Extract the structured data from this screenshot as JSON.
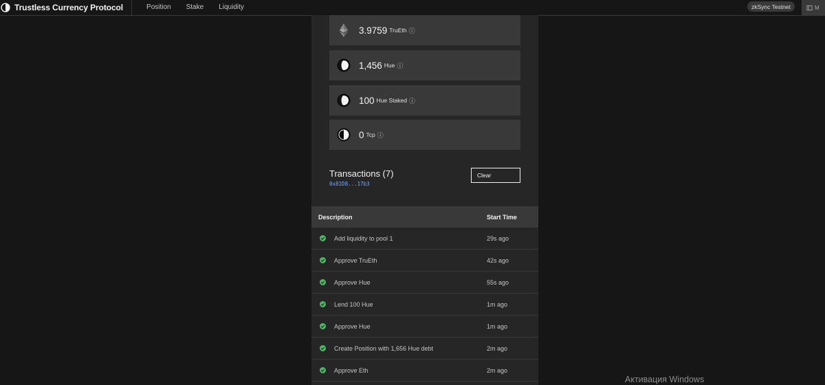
{
  "header": {
    "brand": "Trustless Currency Protocol",
    "nav": [
      "Position",
      "Stake",
      "Liquidity"
    ],
    "network": "zkSync Testnet",
    "wallet_label": "M"
  },
  "balances": [
    {
      "amount": "3.9759",
      "unit": "TruEth",
      "icon": "ethereum-icon"
    },
    {
      "amount": "1,456",
      "unit": "Hue",
      "icon": "hue-icon"
    },
    {
      "amount": "100",
      "unit": "Hue Staked",
      "icon": "hue-staked-icon"
    },
    {
      "amount": "0",
      "unit": "Tcp",
      "icon": "tcp-icon"
    }
  ],
  "info_glyph": "ⓘ",
  "transactions": {
    "title": "Transactions (7)",
    "address": "0x81D8...17b3",
    "clear_label": "Clear",
    "columns": [
      "Description",
      "Start Time"
    ],
    "rows": [
      {
        "description": "Add liquidity to pool 1",
        "time": "29s ago",
        "status": "success"
      },
      {
        "description": "Approve TruEth",
        "time": "42s ago",
        "status": "success"
      },
      {
        "description": "Approve Hue",
        "time": "55s ago",
        "status": "success"
      },
      {
        "description": "Lend 100 Hue",
        "time": "1m ago",
        "status": "success"
      },
      {
        "description": "Approve Hue",
        "time": "1m ago",
        "status": "success"
      },
      {
        "description": "Create Position with 1,656 Hue debt",
        "time": "2m ago",
        "status": "success"
      },
      {
        "description": "Approve Eth",
        "time": "2m ago",
        "status": "success"
      }
    ]
  },
  "watermark": "Активация Windows",
  "colors": {
    "background": "#161616",
    "panel": "#262626",
    "card": "#393939",
    "success": "#42be65",
    "link": "#78a9ff"
  }
}
